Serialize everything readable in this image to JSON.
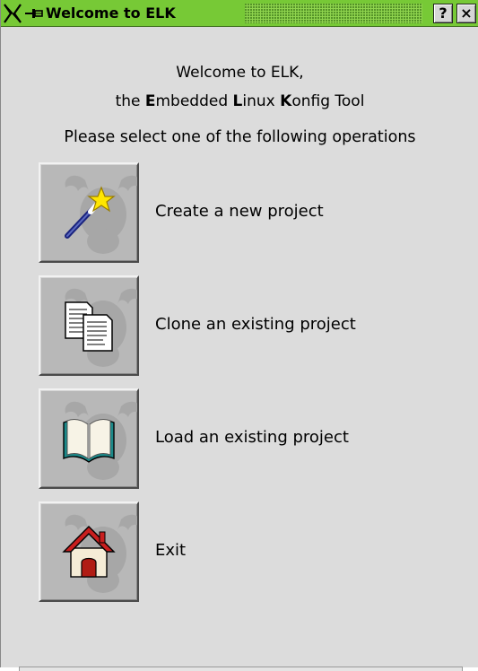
{
  "window": {
    "title": "Welcome to ELK",
    "help_button": "?",
    "close_button": "×",
    "titlebar_color": "#77c936"
  },
  "heading": {
    "line1": "Welcome to ELK,",
    "line2_prefix": "the ",
    "line2_E": "E",
    "line2_mbedded": "mbedded ",
    "line2_L": "L",
    "line2_inux": "inux ",
    "line2_K": "K",
    "line2_onfig": "onfig Tool",
    "line3": "Please select one of the following operations"
  },
  "operations": [
    {
      "label": "Create a new project",
      "icon": "magic-wand-icon"
    },
    {
      "label": "Clone an existing project",
      "icon": "copy-documents-icon"
    },
    {
      "label": "Load an existing project",
      "icon": "open-book-icon"
    },
    {
      "label": "Exit",
      "icon": "house-icon"
    }
  ]
}
